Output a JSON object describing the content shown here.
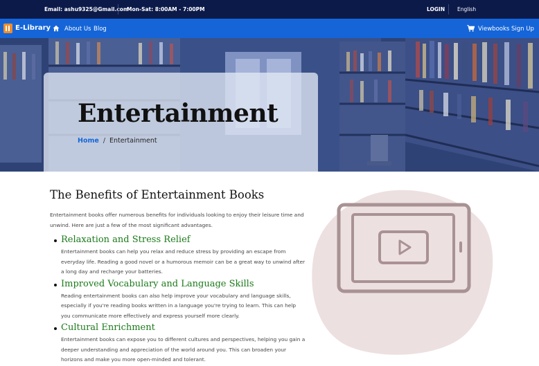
{
  "topbar": {
    "email": "Email: ashu9325@Gmail.com",
    "hours": "Mon-Sat: 8:00AM - 7:00PM",
    "login": "LOGIN",
    "language": "English"
  },
  "navbar": {
    "brand": "E-Library",
    "about": "About Us",
    "blog": "Blog",
    "viewbooks": "Viewbooks",
    "signup": "Sign Up",
    "icons": [
      "home-icon",
      "cart-icon",
      "library-logo-icon"
    ]
  },
  "hero": {
    "title": "Entertainment",
    "breadcrumb_home": "Home",
    "breadcrumb_separator": "/",
    "breadcrumb_current": "Entertainment"
  },
  "main": {
    "heading": "The Benefits of Entertainment Books",
    "intro": "Entertainment books offer numerous benefits for individuals looking to enjoy their leisure time and unwind. Here are just a few of the most significant advantages.",
    "benefits": [
      {
        "title": "Relaxation and Stress Relief",
        "text": "Entertainment books can help you relax and reduce stress by providing an escape from everyday life. Reading a good novel or a humorous memoir can be a great way to unwind after a long day and recharge your batteries."
      },
      {
        "title": "Improved Vocabulary and Language Skills",
        "text": "Reading entertainment books can also help improve your vocabulary and language skills, especially if you're reading books written in a language you're trying to learn. This can help you communicate more effectively and express yourself more clearly."
      },
      {
        "title": "Cultural Enrichment",
        "text": "Entertainment books can expose you to different cultures and perspectives, helping you gain a deeper understanding and appreciation of the world around you. This can broaden your horizons and make you more open-minded and tolerant."
      }
    ]
  },
  "colors": {
    "topbar": "#0c1a4a",
    "navbar": "#1565d8",
    "accent_green": "#1a7a1a",
    "blob": "#ede0e1",
    "device_stroke": "#a99294"
  }
}
